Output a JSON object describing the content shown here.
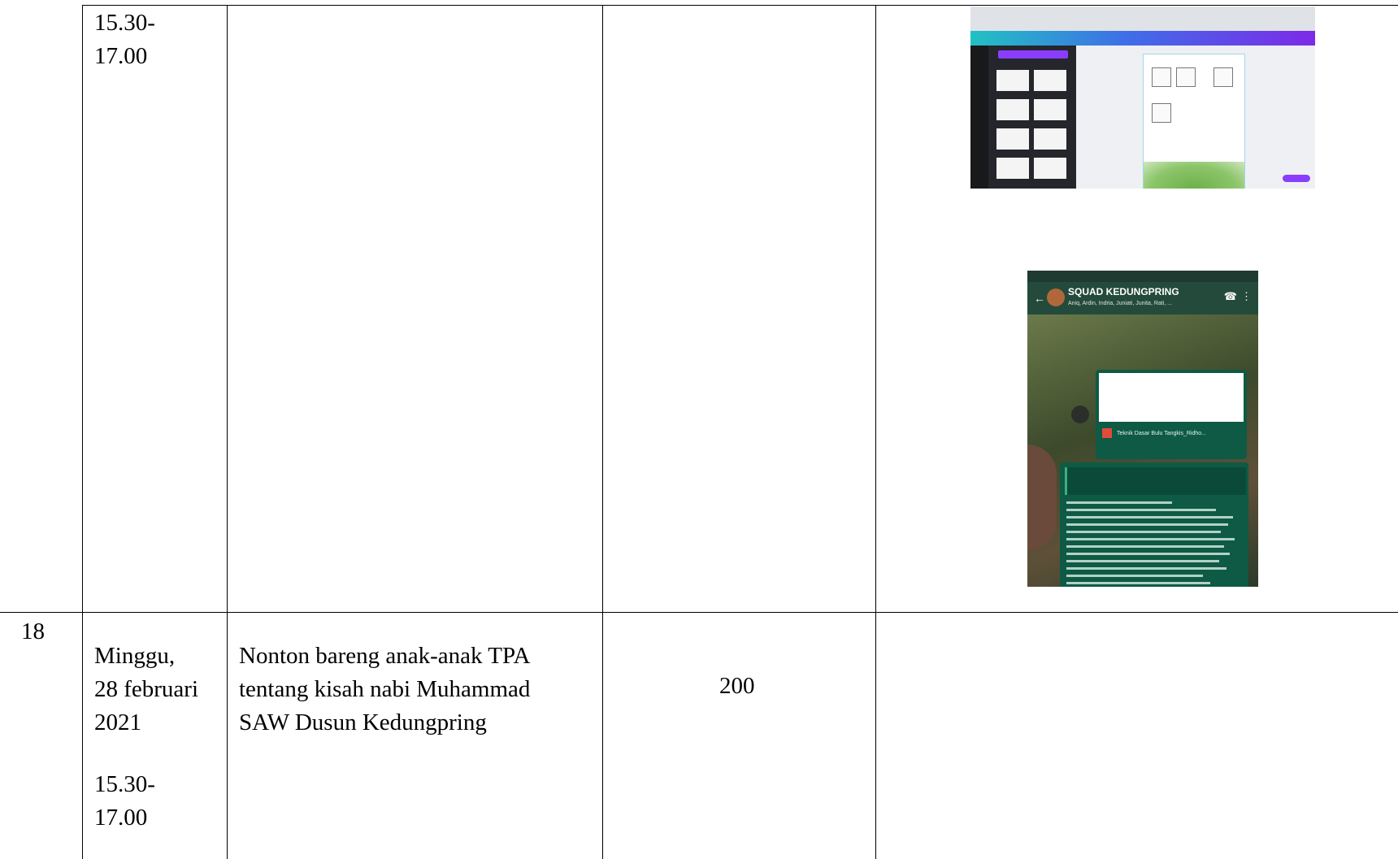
{
  "table": {
    "rows": [
      {
        "number": "",
        "schedule": {
          "date_lines": [],
          "time_lines": [
            "15.30-",
            "17.00"
          ]
        },
        "activity_lines": [],
        "participants": "",
        "documentation": {
          "images": [
            {
              "kind": "canva-editor-screenshot"
            },
            {
              "kind": "whatsapp-group-screenshot",
              "group_name": "SQUAD KEDUNGPRING",
              "members": "Aniq, Ardin, Indria, Juniati, Junita, Rati, ...",
              "document_title": "Teknik Dasar Bulu Tangkis",
              "file_name": "Teknik Dasar Bulu Tangkis_Ridho..."
            }
          ]
        }
      },
      {
        "number": "18",
        "schedule": {
          "date_lines": [
            "Minggu,",
            "28 februari",
            "2021"
          ],
          "time_lines": [
            "15.30-",
            "17.00"
          ]
        },
        "activity_lines": [
          "Nonton bareng anak-anak TPA",
          "tentang kisah nabi Muhammad",
          "SAW Dusun Kedungpring"
        ],
        "participants": "200",
        "documentation": {
          "images": []
        }
      }
    ]
  },
  "colors": {
    "border": "#000000",
    "canva_purple": "#8b3dff",
    "whatsapp_green": "#0e5a45"
  }
}
